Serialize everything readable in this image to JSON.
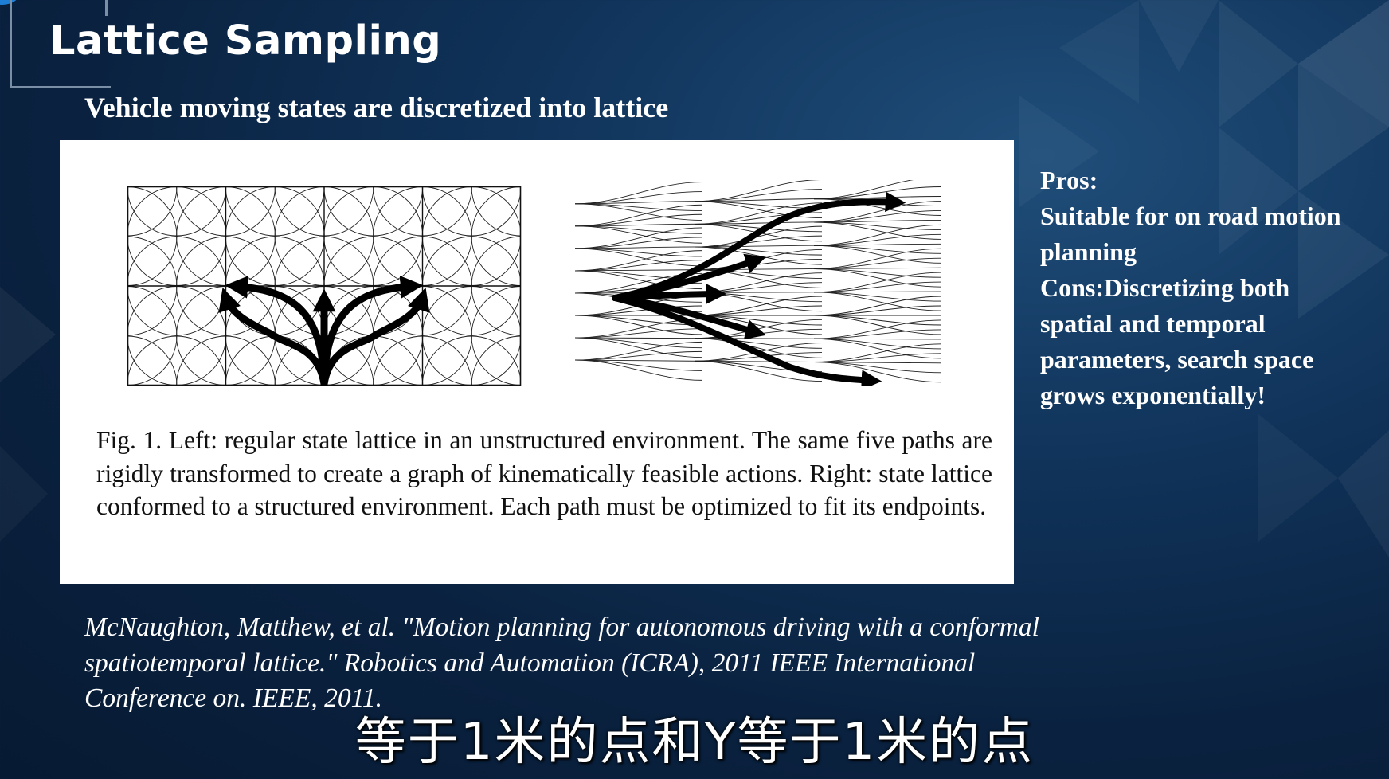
{
  "slide": {
    "title": "Lattice Sampling",
    "subtitle": "Vehicle moving states are discretized into lattice"
  },
  "figure": {
    "caption": "Fig. 1.    Left: regular state lattice in an unstructured environment. The same five paths are rigidly transformed to create a graph of kinematically feasible actions. Right: state lattice conformed to a structured environment. Each path must be optimized to fit its endpoints."
  },
  "pros_cons": {
    "lines": [
      "Pros:",
      "Suitable for on road motion",
      "planning",
      "Cons:Discretizing both",
      "spatial and temporal",
      "parameters, search space",
      "grows exponentially!"
    ]
  },
  "reference": {
    "lines": [
      "McNaughton, Matthew, et al. \"Motion planning for autonomous driving with a conformal",
      "spatiotemporal lattice.\" Robotics and Automation (ICRA), 2011 IEEE International",
      "Conference on. IEEE, 2011."
    ]
  },
  "video_subtitle": "等于1米的点和Y等于1米的点",
  "colors": {
    "background": "#0a2240",
    "accent": "#1e7fd8",
    "text": "#ffffff"
  }
}
